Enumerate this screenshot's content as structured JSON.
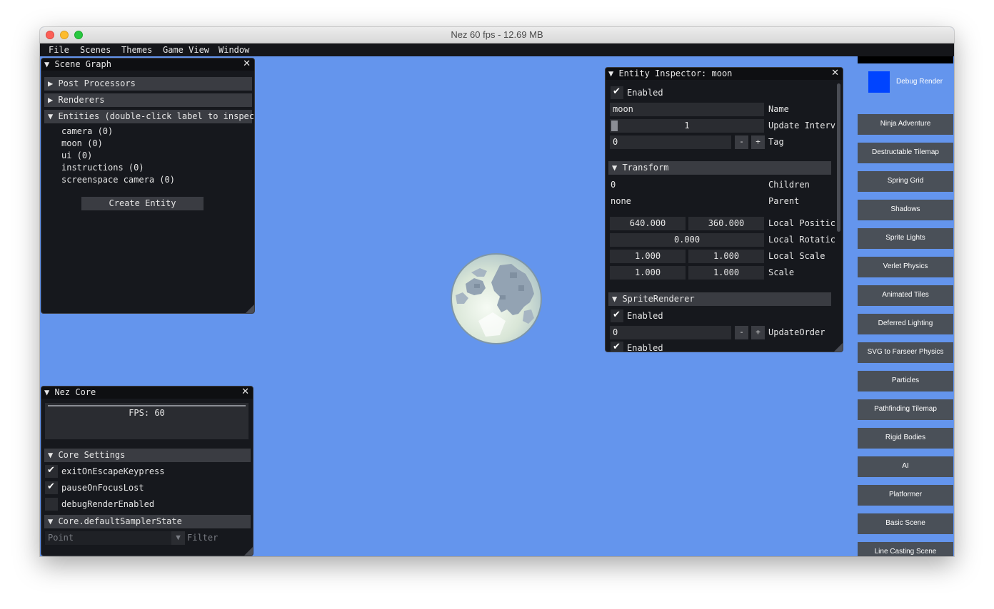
{
  "window": {
    "title": "Nez 60 fps - 12.69 MB"
  },
  "menubar": [
    "File",
    "Scenes",
    "Themes",
    "Game View",
    "Window"
  ],
  "scene_graph": {
    "title": "Scene Graph",
    "sections": [
      "Post Processors",
      "Renderers",
      "Entities (double-click label to inspec"
    ],
    "entities": [
      "camera (0)",
      "moon (0)",
      "ui (0)",
      "instructions (0)",
      "screenspace camera (0)"
    ],
    "create_button": "Create Entity"
  },
  "nez_core": {
    "title": "Nez Core",
    "fps": "FPS: 60",
    "core_settings": "Core Settings",
    "settings": [
      {
        "label": "exitOnEscapeKeypress",
        "checked": true
      },
      {
        "label": "pauseOnFocusLost",
        "checked": true
      },
      {
        "label": "debugRenderEnabled",
        "checked": false
      }
    ],
    "sampler_header": "Core.defaultSamplerState",
    "sampler_value": "Point",
    "sampler_label": "Filter"
  },
  "inspector": {
    "title": "Entity Inspector: moon",
    "enabled_label": "Enabled",
    "name_value": "moon",
    "name_label": "Name",
    "update_interval_value": "1",
    "update_interval_label": "Update Interv",
    "tag_value": "0",
    "tag_label": "Tag",
    "minus": "-",
    "plus": "+",
    "transform_header": "Transform",
    "children_value": "0",
    "children_label": "Children",
    "parent_value": "none",
    "parent_label": "Parent",
    "local_position": [
      "640.000",
      "360.000"
    ],
    "local_position_label": "Local Positic",
    "local_rotation": "0.000",
    "local_rotation_label": "Local Rotatic",
    "local_scale": [
      "1.000",
      "1.000"
    ],
    "local_scale_label": "Local Scale",
    "scale": [
      "1.000",
      "1.000"
    ],
    "scale_label": "Scale",
    "sprite_header": "SpriteRenderer",
    "sprite_enabled_label": "Enabled",
    "update_order_value": "0",
    "update_order_label": "UpdateOrder",
    "sprite_enabled2_label": "Enabled"
  },
  "sidebar": {
    "debug_render_label": "Debug Render",
    "debug_color": "#0044ff",
    "scenes": [
      "Ninja Adventure",
      "Destructable Tilemap",
      "Spring Grid",
      "Shadows",
      "Sprite Lights",
      "Verlet Physics",
      "Animated Tiles",
      "Deferred Lighting",
      "SVG to Farseer Physics",
      "Particles",
      "Pathfinding Tilemap",
      "Rigid Bodies",
      "AI",
      "Platformer",
      "Basic Scene",
      "Line Casting Scene"
    ]
  },
  "colors": {
    "background": "#6495ed",
    "panel": "#16181d",
    "header": "#3a3c42",
    "sidebar_button": "#4a5058"
  }
}
